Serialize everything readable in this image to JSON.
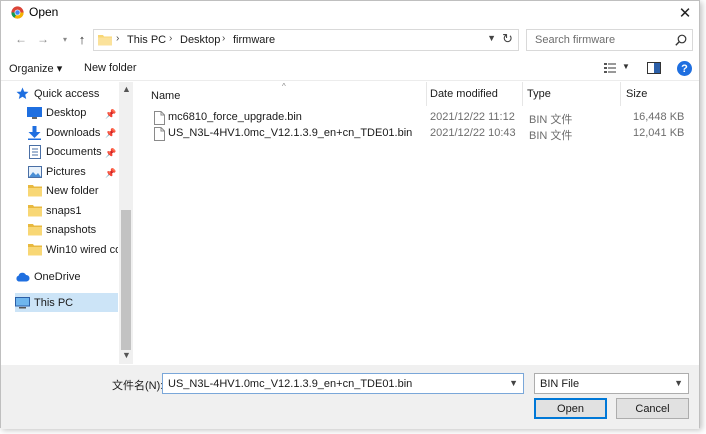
{
  "window": {
    "title": "Open",
    "close_glyph": "✕"
  },
  "address": {
    "crumbs": [
      "This PC",
      "Desktop",
      "firmware"
    ],
    "separator": "›"
  },
  "search": {
    "placeholder": "Search firmware"
  },
  "toolbar": {
    "organize": "Organize ▾",
    "new_folder": "New folder",
    "help": "?"
  },
  "nav": {
    "items": [
      {
        "label": "Quick access",
        "icon": "star-icon",
        "pinned": false
      },
      {
        "label": "Desktop",
        "icon": "desktop-icon",
        "pinned": true
      },
      {
        "label": "Downloads",
        "icon": "download-icon",
        "pinned": true
      },
      {
        "label": "Documents",
        "icon": "document-icon",
        "pinned": true
      },
      {
        "label": "Pictures",
        "icon": "picture-icon",
        "pinned": true
      },
      {
        "label": "New folder",
        "icon": "folder-icon",
        "pinned": false
      },
      {
        "label": "snaps1",
        "icon": "folder-icon",
        "pinned": false
      },
      {
        "label": "snapshots",
        "icon": "folder-icon",
        "pinned": false
      },
      {
        "label": "Win10 wired cor",
        "icon": "folder-icon",
        "pinned": false
      },
      {
        "label": "OneDrive",
        "icon": "cloud-icon",
        "pinned": false
      },
      {
        "label": "This PC",
        "icon": "computer-icon",
        "pinned": false
      }
    ]
  },
  "columns": {
    "name": "Name",
    "date": "Date modified",
    "type": "Type",
    "size": "Size"
  },
  "files": [
    {
      "name": "mc6810_force_upgrade.bin",
      "date": "2021/12/22 11:12",
      "type": "BIN 文件",
      "size": "16,448 KB"
    },
    {
      "name": "US_N3L-4HV1.0mc_V12.1.3.9_en+cn_TDE01.bin",
      "date": "2021/12/22 10:43",
      "type": "BIN 文件",
      "size": "12,041 KB"
    }
  ],
  "bottom": {
    "filename_label": "文件名(N):",
    "filename_value": "US_N3L-4HV1.0mc_V12.1.3.9_en+cn_TDE01.bin",
    "filetype": "BIN File",
    "open": "Open",
    "cancel": "Cancel"
  },
  "colors": {
    "accent": "#0078d7",
    "selection": "#cce4f7",
    "folder": "#f8d775"
  }
}
